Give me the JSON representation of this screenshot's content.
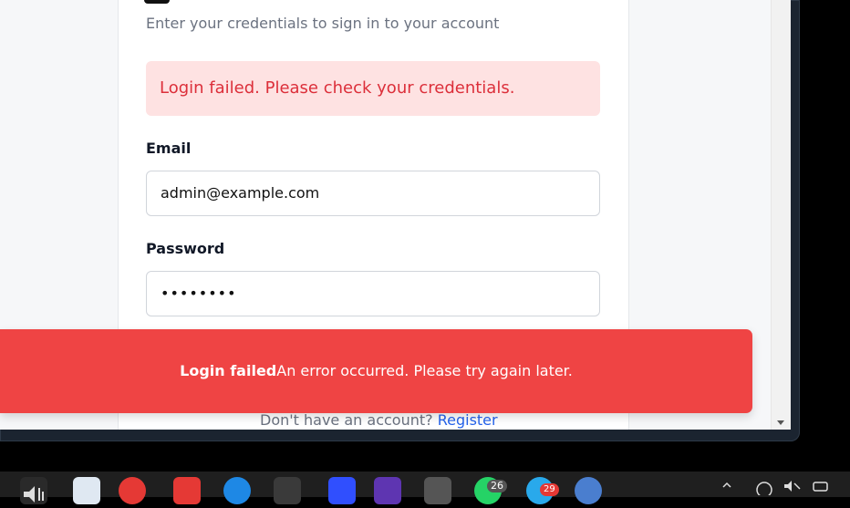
{
  "login": {
    "subtitle": "Enter your credentials to sign in to your account",
    "alert": "Login failed. Please check your credentials.",
    "email_label": "Email",
    "email_value": "admin@example.com",
    "password_label": "Password",
    "password_value": "••••••••",
    "footer_prompt": "Don't have an account?",
    "footer_link": "Register"
  },
  "toast": {
    "title": "Login failed",
    "message": "An error occurred. Please try again later."
  },
  "taskbar": {
    "badge_whatsapp": "26",
    "badge_telegram": "29"
  },
  "colors": {
    "toast_bg": "#ef4444",
    "alert_bg": "#fee2e2",
    "alert_text": "#dc2f3a",
    "link": "#2563eb"
  }
}
